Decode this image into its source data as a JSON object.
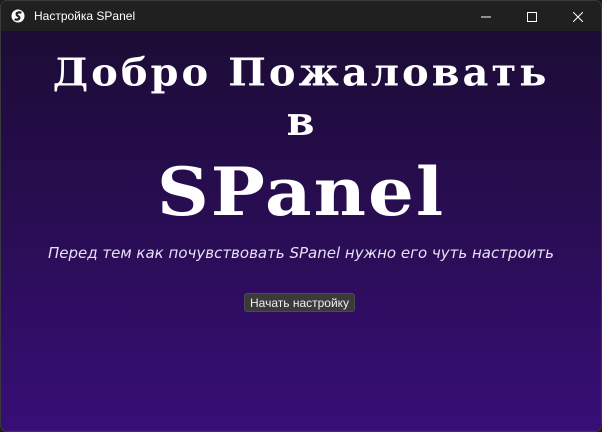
{
  "window": {
    "title": "Настройка SPanel",
    "app_icon": "spanel-logo-icon",
    "controls": [
      "minimize-icon",
      "maximize-icon",
      "close-icon"
    ]
  },
  "welcome": {
    "line1": "Добро Пожаловать",
    "line2": "в",
    "line3": "SPanel",
    "subtitle": "Перед тем как почувствовать SPanel нужно его чуть настроить"
  },
  "actions": {
    "start_setup_label": "Начать настройку"
  },
  "colors": {
    "background_top": "#1c0c35",
    "background_bottom": "#380e77",
    "headline": "#ffffff",
    "button_bg": "#3a3a3a"
  }
}
